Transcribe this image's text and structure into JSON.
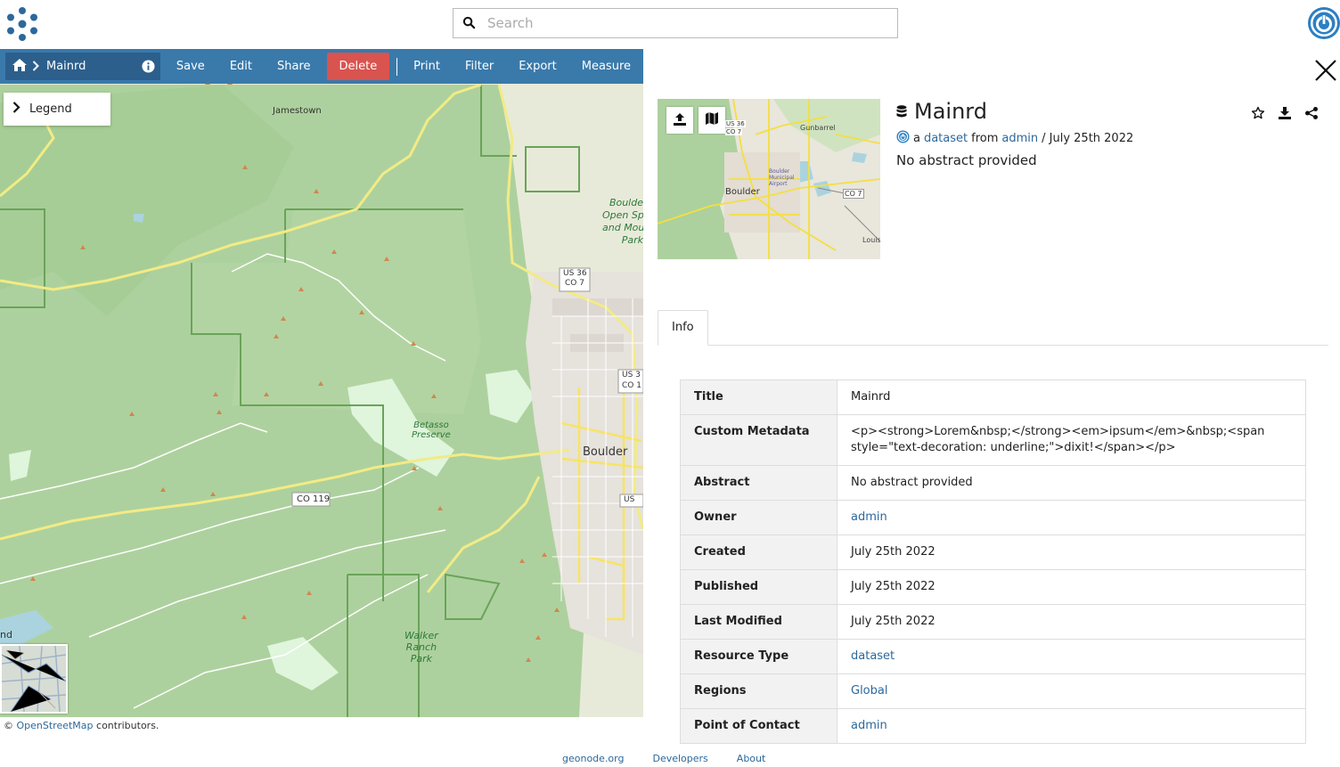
{
  "header": {
    "search_placeholder": "Search"
  },
  "toolbar": {
    "breadcrumb_title": "Mainrd",
    "buttons": {
      "save": "Save",
      "edit": "Edit",
      "share": "Share",
      "delete": "Delete",
      "print": "Print",
      "filter": "Filter",
      "export": "Export",
      "measure": "Measure"
    },
    "colors": {
      "bar": "#397aab",
      "delete": "#d9534f"
    }
  },
  "map": {
    "legend_label": "Legend",
    "labels": {
      "jamestown": "Jamestown",
      "co119": "CO 119",
      "us36": "US 36",
      "co7": "CO 7",
      "betasso1": "Betasso",
      "betasso2": "Preserve",
      "boulder": "Boulder",
      "walker1": "Walker",
      "walker2": "Ranch",
      "walker3": "Park",
      "open1": "Boulde",
      "open2": "Open Sp",
      "open3": "and Mou",
      "open4": "Park",
      "us3": "US 3",
      "co1": "CO 1",
      "edge": "nd",
      "us_edge": "US"
    },
    "attribution": {
      "prefix": "©",
      "link": "OpenStreetMap",
      "suffix": "contributors."
    }
  },
  "panel": {
    "title": "Mainrd",
    "byline": {
      "a": "a",
      "type_link": "dataset",
      "from": "from",
      "owner_link": "admin",
      "date": "/ July 25th 2022"
    },
    "abstract": "No abstract provided",
    "thumb_labels": {
      "niwot": "Gunbarrel",
      "boulder": "Boulder",
      "co7": "CO 7",
      "us36": "US 36",
      "co7b": "CO 7",
      "louis": "Louis",
      "airport": "Boulder Municipal Airport"
    },
    "tab_info": "Info",
    "info_rows": [
      {
        "key": "Title",
        "value": "Mainrd",
        "link": false
      },
      {
        "key": "Custom Metadata",
        "value": "<p><strong>Lorem&nbsp;</strong><em>ipsum</em>&nbsp;<span style=\"text-decoration: underline;\">dixit!</span></p>",
        "link": false
      },
      {
        "key": "Abstract",
        "value": "No abstract provided",
        "link": false
      },
      {
        "key": "Owner",
        "value": "admin",
        "link": true
      },
      {
        "key": "Created",
        "value": "July 25th 2022",
        "link": false
      },
      {
        "key": "Published",
        "value": "July 25th 2022",
        "link": false
      },
      {
        "key": "Last Modified",
        "value": "July 25th 2022",
        "link": false
      },
      {
        "key": "Resource Type",
        "value": "dataset",
        "link": true
      },
      {
        "key": "Regions",
        "value": "Global",
        "link": true
      },
      {
        "key": "Point of Contact",
        "value": "admin",
        "link": true
      }
    ]
  },
  "footer": {
    "links": [
      "geonode.org",
      "Developers",
      "About"
    ]
  }
}
